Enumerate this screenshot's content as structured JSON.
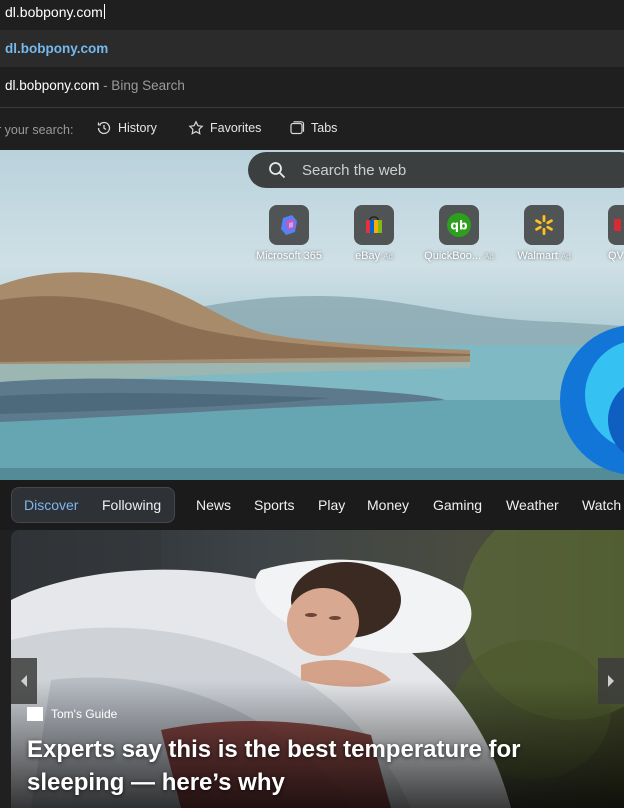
{
  "address_bar": {
    "value": "dl.bobpony.com"
  },
  "suggestions": [
    {
      "text": "dl.bobpony.com"
    },
    {
      "text": "dl.bobpony.com",
      "sub": " - Bing Search"
    }
  ],
  "search_scope": {
    "label": "r your search:",
    "chips": [
      {
        "label": "History",
        "icon": "history-icon"
      },
      {
        "label": "Favorites",
        "icon": "star-icon"
      },
      {
        "label": "Tabs",
        "icon": "tabs-icon"
      }
    ]
  },
  "new_tab": {
    "search_placeholder": "Search the web",
    "quick_links": [
      {
        "label": "Microsoft 365",
        "ad": ""
      },
      {
        "label": "eBay",
        "ad": "Ad"
      },
      {
        "label": "QuickBoo...",
        "ad": "Ad"
      },
      {
        "label": "Walmart",
        "ad": "Ad"
      },
      {
        "label": "QV",
        "ad": ""
      }
    ]
  },
  "feed_nav": {
    "tabs": [
      "Discover",
      "Following"
    ],
    "categories": [
      "News",
      "Sports",
      "Play",
      "Money",
      "Gaming",
      "Weather",
      "Watch"
    ]
  },
  "news_card": {
    "source": "Tom's Guide",
    "headline": "Experts say this is the best temperature for sleeping — here’s why"
  },
  "colors": {
    "accent": "#7cb7ef",
    "suggestion_link": "#76b9ed"
  }
}
